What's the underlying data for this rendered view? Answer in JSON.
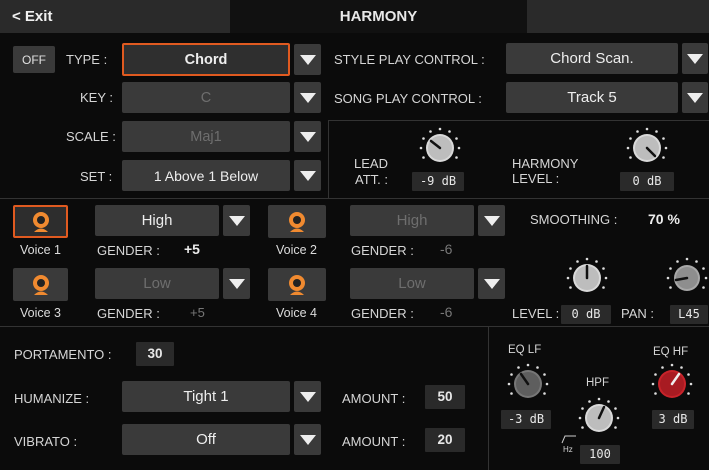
{
  "header": {
    "exit_label": "< Exit",
    "title": "HARMONY"
  },
  "top": {
    "off_label": "OFF",
    "type_label": "TYPE :",
    "type_value": "Chord",
    "key_label": "KEY :",
    "key_value": "C",
    "scale_label": "SCALE :",
    "scale_value": "Maj1",
    "set_label": "SET :",
    "set_value": "1 Above 1 Below",
    "style_play_label": "STYLE PLAY CONTROL :",
    "style_play_value": "Chord Scan.",
    "song_play_label": "SONG PLAY CONTROL :",
    "song_play_value": "Track 5",
    "lead_att_label_1": "LEAD",
    "lead_att_label_2": "ATT. :",
    "lead_att_value": "-9 dB",
    "harmony_level_label_1": "HARMONY",
    "harmony_level_label_2": "LEVEL :",
    "harmony_level_value": "0 dB"
  },
  "voices": {
    "v1": {
      "name": "Voice 1",
      "range": "High",
      "gender_label": "GENDER :",
      "gender": "+5"
    },
    "v2": {
      "name": "Voice 2",
      "range": "High",
      "gender_label": "GENDER :",
      "gender": "-6"
    },
    "v3": {
      "name": "Voice 3",
      "range": "Low",
      "gender_label": "GENDER :",
      "gender": "+5"
    },
    "v4": {
      "name": "Voice 4",
      "range": "Low",
      "gender_label": "GENDER :",
      "gender": "-6"
    },
    "smoothing_label": "SMOOTHING :",
    "smoothing_value": "70 %",
    "level_label": "LEVEL :",
    "level_value": "0 dB",
    "pan_label": "PAN :",
    "pan_value": "L45"
  },
  "bottom": {
    "portamento_label": "PORTAMENTO :",
    "portamento_value": "30",
    "humanize_label": "HUMANIZE :",
    "humanize_value": "Tight 1",
    "humanize_amount_label": "AMOUNT :",
    "humanize_amount_value": "50",
    "vibrato_label": "VIBRATO :",
    "vibrato_value": "Off",
    "vibrato_amount_label": "AMOUNT :",
    "vibrato_amount_value": "20"
  },
  "eq": {
    "lf_label": "EQ LF",
    "lf_value": "-3 dB",
    "hf_label": "EQ HF",
    "hf_value": "3 dB",
    "hpf_label": "HPF",
    "hpf_value": "100",
    "hz_label": "Hz"
  },
  "colors": {
    "accent": "#e05a20",
    "eq_hf_knob": "#c8232a",
    "background": "#0b0b0b",
    "field": "#3a3a3a"
  }
}
